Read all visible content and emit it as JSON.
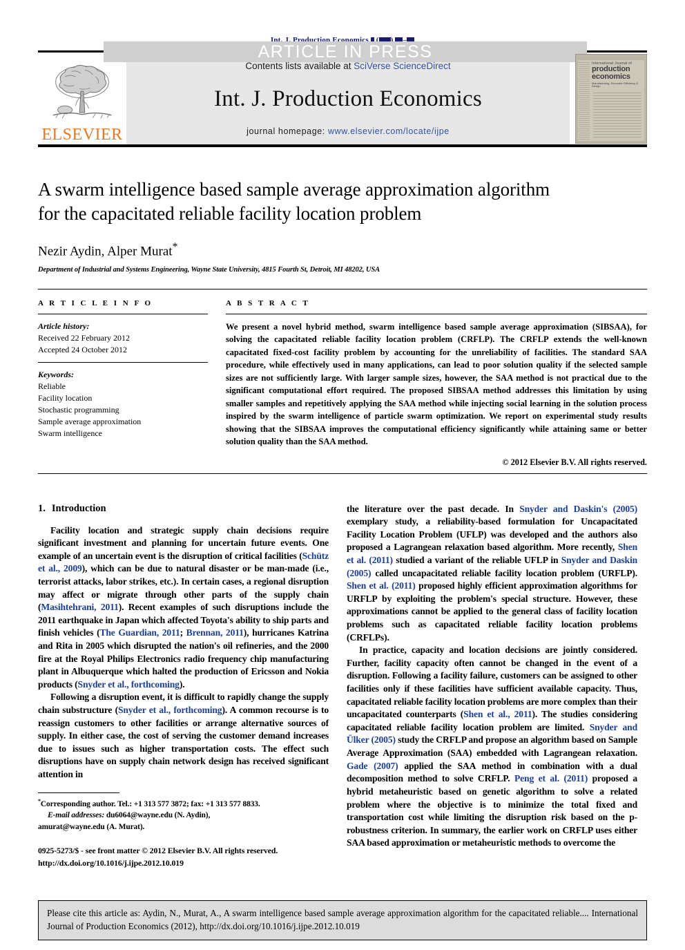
{
  "banner": {
    "text": "ARTICLE IN PRESS"
  },
  "running_head": {
    "prefix": "Int. J. Production Economics",
    "volume_placeholder": "▮ (▮▮▮▮) ▮▮▮–▮▮▮"
  },
  "masthead": {
    "publisher_logo_name": "elsevier-tree-logo",
    "publisher": "ELSEVIER",
    "contents_prefix": "Contents lists available at",
    "contents_link": "SciVerse ScienceDirect",
    "journal_title": "Int. J. Production Economics",
    "homepage_prefix": "journal homepage:",
    "homepage_link": "www.elsevier.com/locate/ijpe",
    "cover": {
      "line1": "International Journal of",
      "line2": "production",
      "line3": "economics",
      "line4": "Manufacturing, Economic Efficiency & Design"
    }
  },
  "article": {
    "title_line1": "A swarm intelligence based sample average approximation algorithm",
    "title_line2": "for the capacitated reliable facility location problem",
    "authors": "Nezir Aydin, Alper Murat",
    "corresponding_marker": "*",
    "affiliation": "Department of Industrial and Systems Engineering, Wayne State University, 4815 Fourth St, Detroit, MI 48202, USA"
  },
  "article_info": {
    "heading": "A R T I C L E   I N F O",
    "history_label": "Article history:",
    "received": "Received 22 February 2012",
    "accepted": "Accepted 24 October 2012",
    "keywords_label": "Keywords:",
    "keywords": [
      "Reliable",
      "Facility location",
      "Stochastic programming",
      "Sample average approximation",
      "Swarm intelligence"
    ]
  },
  "abstract": {
    "heading": "A B S T R A C T",
    "text": "We present a novel hybrid method, swarm intelligence based sample average approximation (SIBSAA), for solving the capacitated reliable facility location problem (CRFLP). The CRFLP extends the well-known capacitated fixed-cost facility problem by accounting for the unreliability of facilities. The standard SAA procedure, while effectively used in many applications, can lead to poor solution quality if the selected sample sizes are not sufficiently large. With larger sample sizes, however, the SAA method is not practical due to the significant computational effort required. The proposed SIBSAA method addresses this limitation by using smaller samples and repetitively applying the SAA method while injecting social learning in the solution process inspired by the swarm intelligence of particle swarm optimization. We report on experimental study results showing that the SIBSAA improves the computational efficiency significantly while attaining same or better solution quality than the SAA method.",
    "copyright": "© 2012 Elsevier B.V. All rights reserved."
  },
  "introduction": {
    "number": "1.",
    "heading": "Introduction",
    "left_paragraphs": [
      {
        "segments": [
          {
            "t": "Facility location and strategic supply chain decisions require significant investment and planning for uncertain future events. One example of an uncertain event is the disruption of critical facilities (",
            "cite": false
          },
          {
            "t": "Schütz et al., 2009",
            "cite": true
          },
          {
            "t": "), which can be due to natural disaster or be man-made (i.e., terrorist attacks, labor strikes, etc.). In certain cases, a regional disruption may affect or migrate through other parts of the supply chain (",
            "cite": false
          },
          {
            "t": "Masihtehrani, 2011",
            "cite": true
          },
          {
            "t": "). Recent examples of such disruptions include the 2011 earthquake in Japan which affected Toyota's ability to ship parts and finish vehicles (",
            "cite": false
          },
          {
            "t": "The Guardian, 2011",
            "cite": true
          },
          {
            "t": "; ",
            "cite": false
          },
          {
            "t": "Brennan, 2011",
            "cite": true
          },
          {
            "t": "), hurricanes Katrina and Rita in 2005 which disrupted the nation's oil refineries, and the 2000 fire at the Royal Philips Electronics radio frequency chip manufacturing plant in Albuquerque which halted the production of Ericsson and Nokia products (",
            "cite": false
          },
          {
            "t": "Snyder et al., forthcoming",
            "cite": true
          },
          {
            "t": ").",
            "cite": false
          }
        ]
      },
      {
        "segments": [
          {
            "t": "Following a disruption event, it is difficult to rapidly change the supply chain substructure (",
            "cite": false
          },
          {
            "t": "Snyder et al., forthcoming",
            "cite": true
          },
          {
            "t": "). A common recourse is to reassign customers to other facilities or arrange alternative sources of supply. In either case, the cost of serving the customer demand increases due to issues such as higher transportation costs. The effect such disruptions have on supply chain network design has received significant attention in",
            "cite": false
          }
        ]
      }
    ],
    "right_paragraphs": [
      {
        "segments": [
          {
            "t": "the literature over the past decade. In ",
            "cite": false
          },
          {
            "t": "Snyder and Daskin's (2005)",
            "cite": true
          },
          {
            "t": " exemplary study, a reliability-based formulation for Uncapacitated Facility Location Problem (UFLP) was developed and the authors also proposed a Lagrangean relaxation based algorithm. More recently, ",
            "cite": false
          },
          {
            "t": "Shen et al. (2011)",
            "cite": true
          },
          {
            "t": " studied a variant of the reliable UFLP in ",
            "cite": false
          },
          {
            "t": "Snyder and Daskin (2005)",
            "cite": true
          },
          {
            "t": " called uncapacitated reliable facility location problem (URFLP). ",
            "cite": false
          },
          {
            "t": "Shen et al. (2011)",
            "cite": true
          },
          {
            "t": " proposed highly efficient approximation algorithms for URFLP by exploiting the problem's special structure. However, these approximations cannot be applied to the general class of facility location problems such as capacitated reliable facility location problems (CRFLPs).",
            "cite": false
          }
        ]
      },
      {
        "segments": [
          {
            "t": "In practice, capacity and location decisions are jointly considered. Further, facility capacity often cannot be changed in the event of a disruption. Following a facility failure, customers can be assigned to other facilities only if these facilities have sufficient available capacity. Thus, capacitated reliable facility location problems are more complex than their uncapacitated counterparts (",
            "cite": false
          },
          {
            "t": "Shen et al., 2011",
            "cite": true
          },
          {
            "t": "). The studies considering capacitated reliable facility location problem are limited. ",
            "cite": false
          },
          {
            "t": "Snyder and Ülker (2005)",
            "cite": true
          },
          {
            "t": " study the CRFLP and propose an algorithm based on Sample Average Approximation (SAA) embedded with Lagrangean relaxation. ",
            "cite": false
          },
          {
            "t": "Gade (2007)",
            "cite": true
          },
          {
            "t": " applied the SAA method in combination with a dual decomposition method to solve CRFLP. ",
            "cite": false
          },
          {
            "t": "Peng et al. (2011)",
            "cite": true
          },
          {
            "t": " proposed a hybrid metaheuristic based on genetic algorithm to solve a related problem where the objective is to minimize the total fixed and transportation cost while limiting the disruption risk based on the p-robustness criterion. In summary, the earlier work on CRFLP uses either SAA based approximation or metaheuristic methods to overcome the",
            "cite": false
          }
        ]
      }
    ]
  },
  "footnote": {
    "marker": "*",
    "corresponding": "Corresponding author. Tel.: +1 313 577 3872; fax: +1 313 577 8833.",
    "email_label": "E-mail addresses:",
    "email1": "du6064@wayne.edu (N. Aydin),",
    "email2": "amurat@wayne.edu (A. Murat)."
  },
  "imprint": {
    "line1": "0925-5273/$ - see front matter © 2012 Elsevier B.V. All rights reserved.",
    "line2": "http://dx.doi.org/10.1016/j.ijpe.2012.10.019"
  },
  "cite_box": {
    "text": "Please cite this article as: Aydin, N., Murat, A., A swarm intelligence based sample average approximation algorithm for the capacitated reliable.... International Journal of Production Economics (2012), http://dx.doi.org/10.1016/j.ijpe.2012.10.019"
  },
  "colors": {
    "banner_bg": "#cfcfcf",
    "masthead_bg": "#e7e7e7",
    "link": "#3352a0",
    "citation": "#1c3f94",
    "elsevier_orange": "#E87722",
    "running_head": "#191970",
    "cite_box_bg": "#dcdcdc"
  }
}
